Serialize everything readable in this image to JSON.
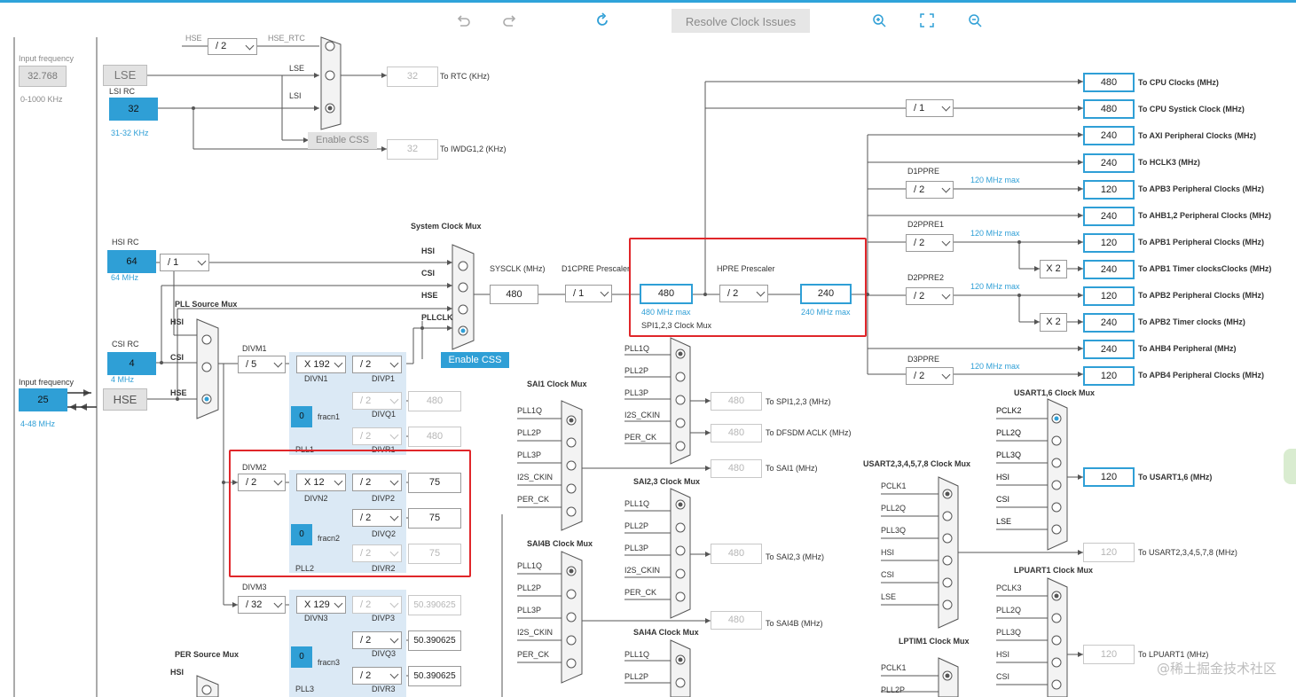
{
  "toolbar": {
    "undo_icon": "undo-icon",
    "redo_icon": "redo-icon",
    "refresh_icon": "refresh-icon",
    "resolve_label": "Resolve Clock Issues",
    "zoom_in_icon": "zoom-in-icon",
    "fit_icon": "fit-screen-icon",
    "zoom_out_icon": "zoom-out-icon"
  },
  "left": {
    "input_freq_label": "Input frequency",
    "lse_input_value": "32.768",
    "lse_range": "0-1000 KHz",
    "lse_label": "LSE",
    "lsi_rc_label": "LSI RC",
    "lsi_value": "32",
    "lsi_range": "31-32 KHz",
    "hsi_rc_label": "HSI RC",
    "hsi_value": "64",
    "hsi_range": "64 MHz",
    "csi_rc_label": "CSI RC",
    "csi_value": "4",
    "csi_range": "4 MHz",
    "hse_input_label": "Input frequency",
    "hse_input_value": "25",
    "hse_range": "4-48 MHz",
    "hse_label": "HSE"
  },
  "rtc": {
    "hse_rtc_div": "/ 2",
    "hse_label": "HSE",
    "hse_rtc_label": "HSE_RTC",
    "lse_label": "LSE",
    "lsi_label": "LSI",
    "rtc_value": "32",
    "rtc_output": "To RTC (KHz)",
    "enable_css": "Enable CSS",
    "iwdg_value": "32",
    "iwdg_output": "To IWDG1,2 (KHz)"
  },
  "hsi_div": "/ 1",
  "sysmux": {
    "title": "System Clock Mux",
    "hsi": "HSI",
    "csi": "CSI",
    "hse": "HSE",
    "pllclk": "PLLCLK",
    "enable_css": "Enable CSS",
    "sysclk_label": "SYSCLK (MHz)",
    "sysclk_value": "480",
    "d1cpre_label": "D1CPRE Prescaler",
    "d1cpre_value": "/ 1",
    "d1_out_value": "480",
    "d1_max": "480 MHz max",
    "hpre_label": "HPRE Prescaler",
    "hpre_value": "/ 2",
    "hpre_out_value": "240",
    "hpre_max": "240 MHz max",
    "spi_mux": "SPI1,2,3 Clock Mux"
  },
  "pll_src": {
    "title": "PLL Source Mux",
    "hsi": "HSI",
    "csi": "CSI",
    "hse": "HSE"
  },
  "pll1": {
    "divm_label": "DIVM1",
    "divm": "/ 5",
    "divn": "X 192",
    "divn_label": "DIVN1",
    "divp": "/ 2",
    "divp_label": "DIVP1",
    "divq": "/ 2",
    "divq_label": "DIVQ1",
    "divr": "/ 2",
    "divr_label": "DIVR1",
    "frac": "0",
    "frac_label": "fracn1",
    "name": "PLL1",
    "q_value": "480",
    "r_value": "480"
  },
  "pll2": {
    "divm_label": "DIVM2",
    "divm": "/ 2",
    "divn": "X 12",
    "divn_label": "DIVN2",
    "divp": "/ 2",
    "divp_label": "DIVP2",
    "divq": "/ 2",
    "divq_label": "DIVQ2",
    "divr": "/ 2",
    "divr_label": "DIVR2",
    "frac": "0",
    "frac_label": "fracn2",
    "name": "PLL2",
    "p_value": "75",
    "q_value": "75",
    "r_value": "75"
  },
  "pll3": {
    "divm_label": "DIVM3",
    "divm": "/ 32",
    "divn": "X 129",
    "divn_label": "DIVN3",
    "divp": "/ 2",
    "divp_label": "DIVP3",
    "divq": "/ 2",
    "divq_label": "DIVQ3",
    "divr": "/ 2",
    "divr_label": "DIVR3",
    "frac": "0",
    "frac_label": "fracn3",
    "name": "PLL3",
    "p_value": "50.390625",
    "q_value": "50.390625",
    "r_value": "50.390625"
  },
  "per_mux": {
    "title": "PER Source Mux",
    "hsi": "HSI"
  },
  "sai1": {
    "title": "SAI1 Clock Mux",
    "in1": "PLL1Q",
    "in2": "PLL2P",
    "in3": "PLL3P",
    "in4": "I2S_CKIN",
    "in5": "PER_CK",
    "out_value": "480",
    "out_label": "To SAI1 (MHz)"
  },
  "sai4b": {
    "title": "SAI4B Clock Mux",
    "in1": "PLL1Q",
    "in2": "PLL2P",
    "in3": "PLL3P",
    "in4": "I2S_CKIN",
    "in5": "PER_CK",
    "out_value": "480",
    "out_label": "To SAI4B (MHz)"
  },
  "spi": {
    "in1": "PLL1Q",
    "in2": "PLL2P",
    "in3": "PLL3P",
    "in4": "I2S_CKIN",
    "in5": "PER_CK",
    "spi_value": "480",
    "spi_label": "To SPI1,2,3 (MHz)",
    "dfsdm_value": "480",
    "dfsdm_label": "To DFSDM ACLK (MHz)"
  },
  "sai23": {
    "title": "SAI2,3 Clock Mux",
    "in1": "PLL1Q",
    "in2": "PLL2P",
    "in3": "PLL3P",
    "in4": "I2S_CKIN",
    "in5": "PER_CK",
    "out_value": "480",
    "out_label": "To SAI2,3 (MHz)"
  },
  "sai4a": {
    "title": "SAI4A Clock Mux",
    "in1": "PLL1Q",
    "in2": "PLL2P"
  },
  "right": {
    "cpu": "480",
    "cpu_label": "To CPU Clocks (MHz)",
    "systick_div": "/ 1",
    "systick": "480",
    "systick_label": "To CPU Systick Clock (MHz)",
    "axi": "240",
    "axi_label": "To AXI Peripheral Clocks (MHz)",
    "hclk3": "240",
    "hclk3_label": "To HCLK3 (MHz)",
    "d1ppre_label": "D1PPRE",
    "d1ppre": "/ 2",
    "max120a": "120 MHz max",
    "apb3": "120",
    "apb3_label": "To APB3 Peripheral Clocks (MHz)",
    "ahb12": "240",
    "ahb12_label": "To AHB1,2 Peripheral Clocks (MHz)",
    "d2ppre1_label": "D2PPRE1",
    "d2ppre1": "/ 2",
    "max120b": "120 MHz max",
    "apb1": "120",
    "apb1_label": "To APB1 Peripheral Clocks (MHz)",
    "x2a": "X 2",
    "apb1t": "240",
    "apb1t_label": "To APB1 Timer clocksClocks (MHz)",
    "d2ppre2_label": "D2PPRE2",
    "d2ppre2": "/ 2",
    "max120c": "120 MHz max",
    "apb2": "120",
    "apb2_label": "To APB2 Peripheral Clocks (MHz)",
    "x2b": "X 2",
    "apb2t": "240",
    "apb2t_label": "To APB2 Timer clocks (MHz)",
    "ahb4": "240",
    "ahb4_label": "To AHB4 Peripheral (MHz)",
    "d3ppre_label": "D3PPRE",
    "d3ppre": "/ 2",
    "max120d": "120 MHz max",
    "apb4": "120",
    "apb4_label": "To APB4 Peripheral Clocks (MHz)"
  },
  "usart16": {
    "title": "USART1,6 Clock Mux",
    "in1": "PCLK2",
    "in2": "PLL2Q",
    "in3": "PLL3Q",
    "in4": "HSI",
    "in5": "CSI",
    "in6": "LSE",
    "out_value": "120",
    "out_label": "To USART1,6 (MHz)"
  },
  "usart2": {
    "title": "USART2,3,4,5,7,8 Clock Mux",
    "in1": "PCLK1",
    "in2": "PLL2Q",
    "in3": "PLL3Q",
    "in4": "HSI",
    "in5": "CSI",
    "in6": "LSE",
    "out_value": "120",
    "out_label": "To USART2,3,4,5,7,8 (MHz)"
  },
  "lpuart": {
    "title": "LPUART1 Clock Mux",
    "in1": "PCLK3",
    "in2": "PLL2Q",
    "in3": "PLL3Q",
    "in4": "HSI",
    "in5": "CSI",
    "out_value": "120",
    "out_label": "To LPUART1 (MHz)"
  },
  "lptim": {
    "title": "LPTIM1 Clock Mux",
    "in1": "PCLK1",
    "in2": "PLL2P"
  },
  "watermark": "@稀土掘金技术社区"
}
